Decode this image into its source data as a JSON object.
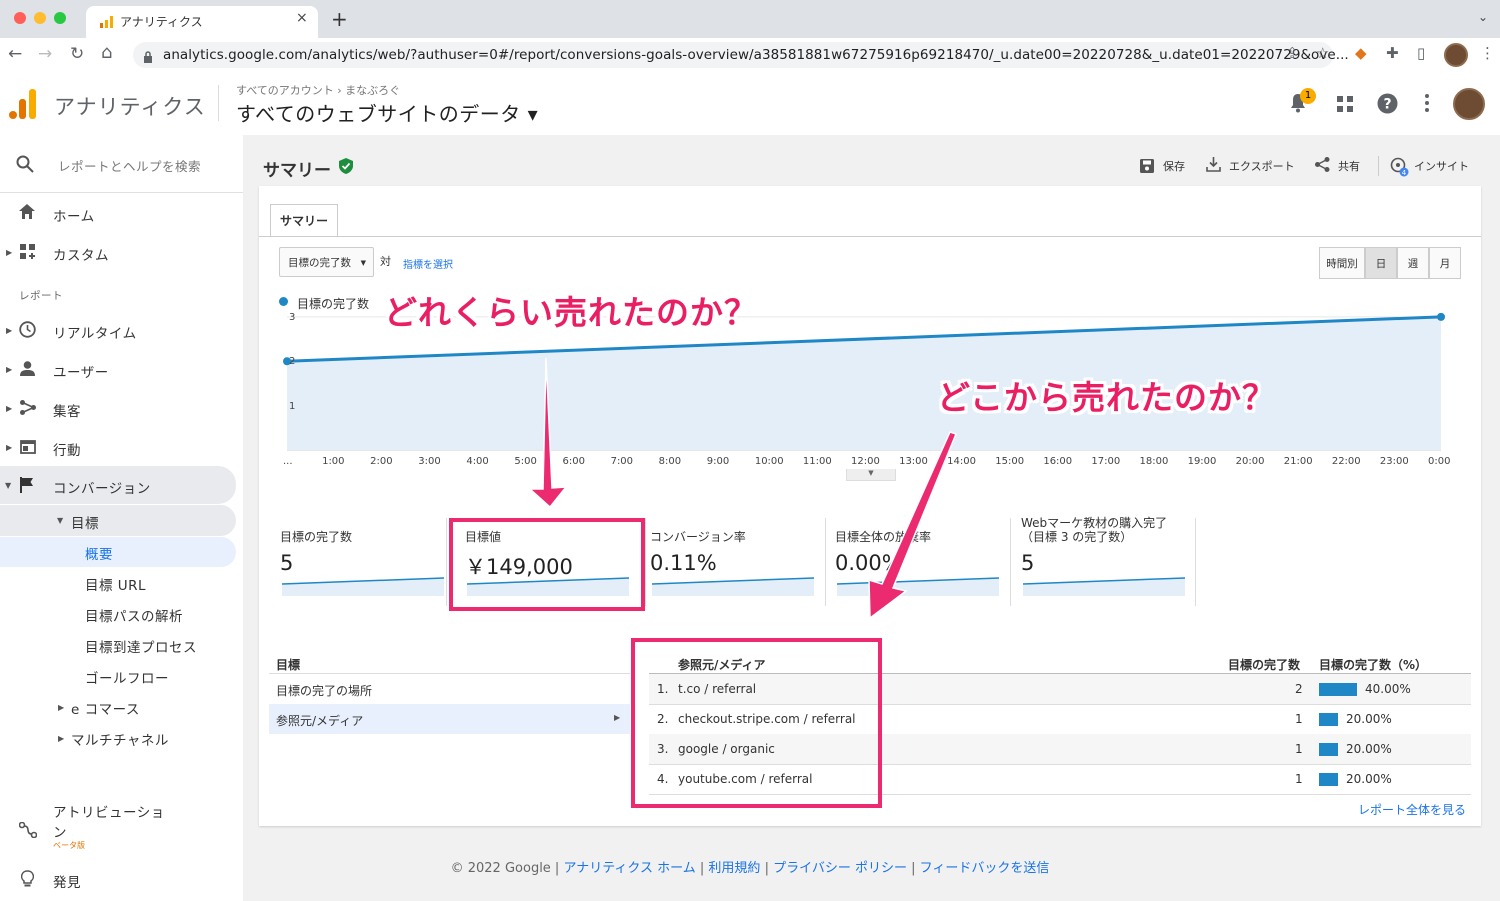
{
  "browser": {
    "tab_title": "アナリティクス",
    "tab_close": "×",
    "new_tab": "+",
    "url": "analytics.google.com/analytics/web/?authuser=0#/report/conversions-goals-overview/a38581881w67275916p69218470/_u.date00=20220728&_u.date01=20220729&ove...",
    "back": "←",
    "forward": "→",
    "reload": "↻",
    "home": "⌂",
    "menu": "⋮"
  },
  "header": {
    "app_name": "アナリティクス",
    "breadcrumb": "すべてのアカウント › まなぶろぐ",
    "property": "すべてのウェブサイトのデータ ▾",
    "notification_count": "1"
  },
  "sidebar": {
    "search_placeholder": "レポートとヘルプを検索",
    "home": "ホーム",
    "custom": "カスタム",
    "reports_section": "レポート",
    "realtime": "リアルタイム",
    "users": "ユーザー",
    "acquisition": "集客",
    "behavior": "行動",
    "conversions": "コンバージョン",
    "goals": "目標",
    "overview": "概要",
    "goal_urls": "目標 URL",
    "reverse_goal_path": "目標パスの解析",
    "funnel": "目標到達プロセス",
    "goal_flow": "ゴールフロー",
    "ecommerce": "e コマース",
    "multichannel": "マルチチャネル",
    "attribution": "アトリビューション",
    "beta": "ベータ版",
    "discover": "発見"
  },
  "report": {
    "title": "サマリー",
    "actions": {
      "save": "保存",
      "export": "エクスポート",
      "share": "共有",
      "insights": "インサイト"
    },
    "tab": "サマリー",
    "metric_select": "目標の完了数",
    "vs": "対",
    "select_metric": "指標を選択",
    "granularity": [
      "時間別",
      "日",
      "週",
      "月"
    ],
    "legend": "目標の完了数"
  },
  "annotations": {
    "how_much": "どれくらい売れたのか？",
    "where_from": "どこから売れたのか？"
  },
  "chart_data": {
    "type": "area",
    "series": [
      {
        "name": "目標の完了数",
        "values": [
          2,
          3
        ]
      }
    ],
    "x_ticks": [
      "...",
      "1:00",
      "2:00",
      "3:00",
      "4:00",
      "5:00",
      "6:00",
      "7:00",
      "8:00",
      "9:00",
      "10:00",
      "11:00",
      "12:00",
      "13:00",
      "14:00",
      "15:00",
      "16:00",
      "17:00",
      "18:00",
      "19:00",
      "20:00",
      "21:00",
      "22:00",
      "23:00",
      "0:00"
    ],
    "y_ticks": [
      "3",
      "2",
      "1"
    ],
    "ylim": [
      0,
      3.2
    ],
    "color": "#1f87c6"
  },
  "metrics": [
    {
      "label": "目標の完了数",
      "value": "5"
    },
    {
      "label": "目標値",
      "value": "￥149,000"
    },
    {
      "label": "コンバージョン率",
      "value": "0.11%"
    },
    {
      "label": "目標全体の放棄率",
      "value": "0.00%"
    },
    {
      "label": "Webマーケ教材の購入完了\n（目標 3 の完了数）",
      "value": "5"
    }
  ],
  "goals_table": {
    "left_header": "目標",
    "left_items": [
      "目標の完了の場所",
      "参照元/メディア"
    ],
    "headers": [
      "参照元/メディア",
      "目標の完了数",
      "目標の完了数（%）"
    ],
    "rows": [
      {
        "rank": "1.",
        "source": "t.co / referral",
        "count": "2",
        "pct": "40.00%",
        "fraction": 0.4
      },
      {
        "rank": "2.",
        "source": "checkout.stripe.com / referral",
        "count": "1",
        "pct": "20.00%",
        "fraction": 0.2
      },
      {
        "rank": "3.",
        "source": "google / organic",
        "count": "1",
        "pct": "20.00%",
        "fraction": 0.2
      },
      {
        "rank": "4.",
        "source": "youtube.com / referral",
        "count": "1",
        "pct": "20.00%",
        "fraction": 0.2
      }
    ],
    "view_full": "レポート全体を見る"
  },
  "footer": {
    "copyright": "© 2022 Google | ",
    "links": [
      "アナリティクス ホーム",
      "利用規約",
      "プライバシー ポリシー",
      "フィードバックを送信"
    ]
  }
}
